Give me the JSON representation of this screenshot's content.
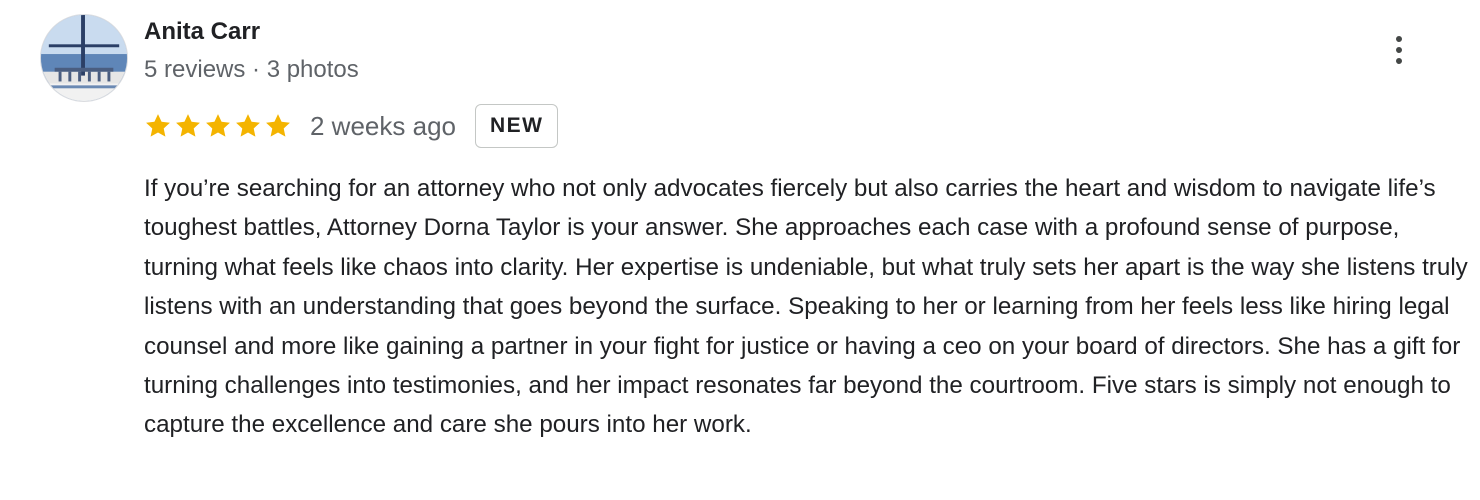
{
  "review": {
    "author": {
      "name": "Anita Carr",
      "meta": "5 reviews · 3 photos",
      "avatar_icon": "avatar-photo-icon"
    },
    "rating": {
      "value": 5,
      "max": 5,
      "star_color": "#f4b400",
      "empty_star_color": "#dadce0"
    },
    "date": "2 weeks ago",
    "badge": "NEW",
    "more_icon": "more-vert-icon",
    "text": "If you’re searching for an attorney who not only advocates fiercely but also carries the heart and wisdom to navigate life’s toughest battles, Attorney Dorna Taylor is your answer. She approaches each case with a profound sense of purpose, turning what feels like chaos into clarity. Her expertise is undeniable, but what truly sets her apart is the way she listens truly listens with an understanding that goes beyond the surface. Speaking to her or learning from her feels less like hiring legal counsel and more like gaining a partner in your fight for justice or having a ceo on your board of directors. She has a gift for turning challenges into testimonies, and her impact resonates far beyond the courtroom. Five stars is simply not enough to capture the excellence and care she pours into her work."
  }
}
